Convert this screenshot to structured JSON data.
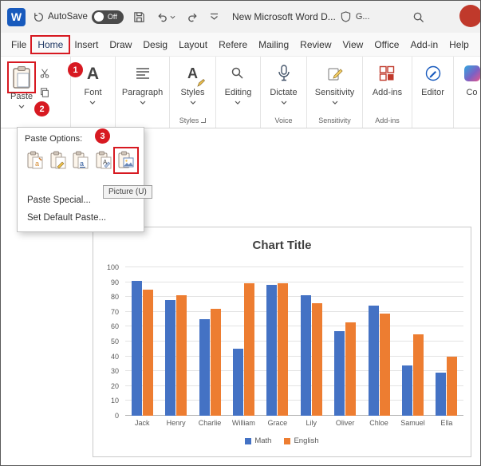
{
  "window": {
    "titlebar": {
      "autosave_label": "AutoSave",
      "autosave_state": "Off",
      "title": "New Microsoft Word D...",
      "sensitivity_badge": "G..."
    },
    "tabs": [
      "File",
      "Home",
      "Insert",
      "Draw",
      "Desig",
      "Layout",
      "Refere",
      "Mailing",
      "Review",
      "View",
      "Office",
      "Add-in",
      "Help"
    ],
    "active_tab": "Home"
  },
  "ribbon": {
    "paste_label": "Paste",
    "font_label": "Font",
    "paragraph_label": "Paragraph",
    "styles_label": "Styles",
    "editing_label": "Editing",
    "dictate_label": "Dictate",
    "sensitivity_label": "Sensitivity",
    "addins_label": "Add-ins",
    "editor_label": "Editor",
    "copilot_label": "Co",
    "group_labels": {
      "styles": "Styles",
      "voice": "Voice",
      "sensitivity": "Sensitivity",
      "addins": "Add-ins"
    }
  },
  "paste_menu": {
    "header": "Paste Options:",
    "options": [
      "keep-source-formatting",
      "merge-formatting",
      "use-destination-styles",
      "keep-text-only",
      "picture"
    ],
    "tooltip": "Picture (U)",
    "item_paste_special": "Paste Special...",
    "item_set_default": "Set Default Paste..."
  },
  "annotations": {
    "step1": "1",
    "step2": "2",
    "step3": "3",
    "color": "#d71921"
  },
  "colors": {
    "accent": "#2b579a",
    "icon_blue": "#185abd",
    "bar_math": "#4472c4",
    "bar_english": "#ed7d31"
  },
  "chart_data": {
    "type": "bar",
    "title": "Chart Title",
    "categories": [
      "Jack",
      "Henry",
      "Charlie",
      "William",
      "Grace",
      "Lily",
      "Oliver",
      "Chloe",
      "Samuel",
      "Ella"
    ],
    "series": [
      {
        "name": "Math",
        "color": "#4472c4",
        "values": [
          91,
          78,
          65,
          45,
          88,
          81,
          57,
          74,
          34,
          29
        ]
      },
      {
        "name": "English",
        "color": "#ed7d31",
        "values": [
          85,
          81,
          72,
          89,
          89,
          76,
          63,
          69,
          55,
          40
        ]
      }
    ],
    "ylim": [
      0,
      100
    ],
    "ytick_step": 10,
    "grid": true,
    "legend_position": "bottom"
  }
}
